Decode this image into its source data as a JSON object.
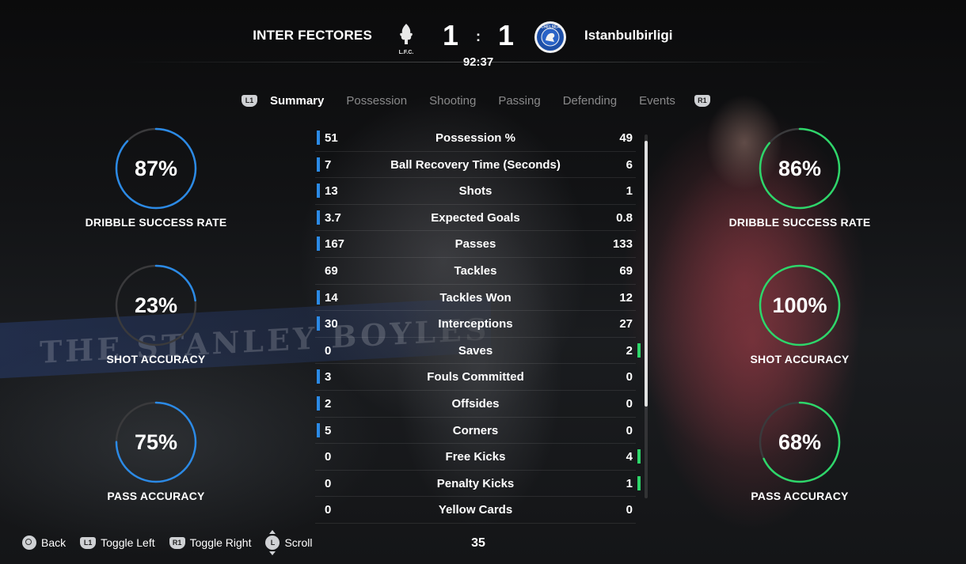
{
  "match": {
    "home_team": "INTER FECTORES",
    "away_team": "Istanbulbirligi",
    "home_score": "1",
    "separator": ":",
    "away_score": "1",
    "clock": "92:37",
    "home_crest_text": "L.F.C.",
    "away_crest_text": "CHELSEA"
  },
  "tabs": {
    "left_button": "L1",
    "right_button": "R1",
    "items": [
      "Summary",
      "Possession",
      "Shooting",
      "Passing",
      "Defending",
      "Events"
    ],
    "active": "Summary"
  },
  "home_gauges": [
    {
      "value": "87%",
      "fraction": 0.87,
      "label": "DRIBBLE SUCCESS RATE"
    },
    {
      "value": "23%",
      "fraction": 0.23,
      "label": "SHOT ACCURACY"
    },
    {
      "value": "75%",
      "fraction": 0.75,
      "label": "PASS ACCURACY"
    }
  ],
  "away_gauges": [
    {
      "value": "86%",
      "fraction": 0.86,
      "label": "DRIBBLE SUCCESS RATE"
    },
    {
      "value": "100%",
      "fraction": 1.0,
      "label": "SHOT ACCURACY"
    },
    {
      "value": "68%",
      "fraction": 0.68,
      "label": "PASS ACCURACY"
    }
  ],
  "stats": [
    {
      "label": "Possession %",
      "home": "51",
      "away": "49",
      "leader": "home"
    },
    {
      "label": "Ball Recovery Time (Seconds)",
      "home": "7",
      "away": "6",
      "leader": "home"
    },
    {
      "label": "Shots",
      "home": "13",
      "away": "1",
      "leader": "home"
    },
    {
      "label": "Expected Goals",
      "home": "3.7",
      "away": "0.8",
      "leader": "home"
    },
    {
      "label": "Passes",
      "home": "167",
      "away": "133",
      "leader": "home"
    },
    {
      "label": "Tackles",
      "home": "69",
      "away": "69",
      "leader": "none"
    },
    {
      "label": "Tackles Won",
      "home": "14",
      "away": "12",
      "leader": "home"
    },
    {
      "label": "Interceptions",
      "home": "30",
      "away": "27",
      "leader": "home"
    },
    {
      "label": "Saves",
      "home": "0",
      "away": "2",
      "leader": "away"
    },
    {
      "label": "Fouls Committed",
      "home": "3",
      "away": "0",
      "leader": "home"
    },
    {
      "label": "Offsides",
      "home": "2",
      "away": "0",
      "leader": "home"
    },
    {
      "label": "Corners",
      "home": "5",
      "away": "0",
      "leader": "home"
    },
    {
      "label": "Free Kicks",
      "home": "0",
      "away": "4",
      "leader": "away"
    },
    {
      "label": "Penalty Kicks",
      "home": "0",
      "away": "1",
      "leader": "away"
    },
    {
      "label": "Yellow Cards",
      "home": "0",
      "away": "0",
      "leader": "none"
    }
  ],
  "colors": {
    "home_accent": "#2b8ae6",
    "away_accent": "#2ed66a",
    "gauge_track": "#3a3a3c"
  },
  "footer": {
    "back": "Back",
    "toggle_left_button": "L1",
    "toggle_left": "Toggle Left",
    "toggle_right_button": "R1",
    "toggle_right": "Toggle Right",
    "scroll_button": "L",
    "scroll": "Scroll",
    "page_number": "35"
  },
  "background": {
    "banner_text": "THE STANLEY BOYLES"
  }
}
